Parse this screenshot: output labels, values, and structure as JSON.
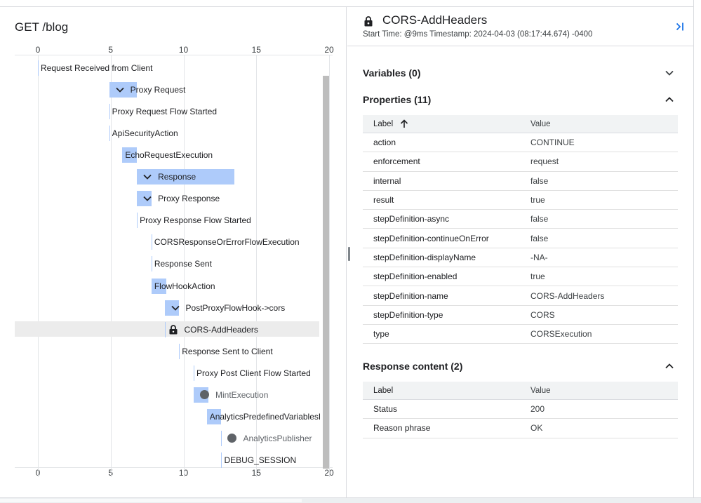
{
  "left_panel": {
    "title": "GET /blog",
    "axis_ticks": [
      "0",
      "5",
      "10",
      "15",
      "20"
    ],
    "axis_max": 20,
    "events": [
      {
        "label": "Request Received from Client",
        "start": 0,
        "end": 0,
        "expandable": false,
        "marker": "none"
      },
      {
        "label": "Proxy Request",
        "start": 4.9,
        "end": 6.8,
        "expandable": true,
        "marker": "chevron"
      },
      {
        "label": "Proxy Request Flow Started",
        "start": 4.9,
        "end": 4.9,
        "expandable": false,
        "marker": "none"
      },
      {
        "label": "ApiSecurityAction",
        "start": 4.9,
        "end": 4.9,
        "expandable": false,
        "marker": "none"
      },
      {
        "label": "EchoRequestExecution",
        "start": 5.8,
        "end": 6.8,
        "expandable": false,
        "marker": "none"
      },
      {
        "label": "Response",
        "start": 6.8,
        "end": 13.5,
        "expandable": true,
        "marker": "chevron"
      },
      {
        "label": "Proxy Response",
        "start": 6.8,
        "end": 7.8,
        "expandable": true,
        "marker": "chevron"
      },
      {
        "label": "Proxy Response Flow Started",
        "start": 6.8,
        "end": 6.8,
        "expandable": false,
        "marker": "none"
      },
      {
        "label": "CORSResponseOrErrorFlowExecution",
        "start": 7.8,
        "end": 7.8,
        "expandable": false,
        "marker": "none"
      },
      {
        "label": "Response Sent",
        "start": 7.8,
        "end": 7.8,
        "expandable": false,
        "marker": "none"
      },
      {
        "label": "FlowHookAction",
        "start": 7.8,
        "end": 8.8,
        "expandable": false,
        "marker": "none"
      },
      {
        "label": "PostProxyFlowHook->cors",
        "start": 8.7,
        "end": 9.7,
        "expandable": true,
        "marker": "chevron"
      },
      {
        "label": "CORS-AddHeaders",
        "start": 8.7,
        "end": 8.7,
        "expandable": false,
        "marker": "lock",
        "selected": true
      },
      {
        "label": "Response Sent to Client",
        "start": 9.7,
        "end": 9.7,
        "expandable": false,
        "marker": "none"
      },
      {
        "label": "Proxy Post Client Flow Started",
        "start": 10.7,
        "end": 10.7,
        "expandable": false,
        "marker": "none"
      },
      {
        "label": "MintExecution",
        "start": 10.7,
        "end": 11.7,
        "expandable": false,
        "marker": "dot",
        "muted": true
      },
      {
        "label": "AnalyticsPredefinedVariablesP",
        "start": 11.6,
        "end": 12.6,
        "expandable": false,
        "marker": "none"
      },
      {
        "label": "AnalyticsPublisher",
        "start": 12.6,
        "end": 12.6,
        "expandable": false,
        "marker": "dot",
        "muted": true
      },
      {
        "label": "DEBUG_SESSION",
        "start": 12.6,
        "end": 12.6,
        "expandable": false,
        "marker": "none"
      }
    ]
  },
  "right_panel": {
    "title": "CORS-AddHeaders",
    "subtitle": "Start Time: @9ms Timestamp: 2024-04-03 (08:17:44.674) -0400",
    "variables": {
      "title": "Variables (0)"
    },
    "properties": {
      "title": "Properties (11)",
      "col_label": "Label",
      "col_value": "Value",
      "rows": [
        {
          "label": "action",
          "value": "CONTINUE"
        },
        {
          "label": "enforcement",
          "value": "request"
        },
        {
          "label": "internal",
          "value": "false"
        },
        {
          "label": "result",
          "value": "true"
        },
        {
          "label": "stepDefinition-async",
          "value": "false"
        },
        {
          "label": "stepDefinition-continueOnError",
          "value": "false"
        },
        {
          "label": "stepDefinition-displayName",
          "value": "-NA-"
        },
        {
          "label": "stepDefinition-enabled",
          "value": "true"
        },
        {
          "label": "stepDefinition-name",
          "value": "CORS-AddHeaders"
        },
        {
          "label": "stepDefinition-type",
          "value": "CORS"
        },
        {
          "label": "type",
          "value": "CORSExecution"
        }
      ]
    },
    "response_content": {
      "title": "Response content (2)",
      "col_label": "Label",
      "col_value": "Value",
      "rows": [
        {
          "label": "Status",
          "value": "200"
        },
        {
          "label": "Reason phrase",
          "value": "OK"
        }
      ]
    }
  },
  "colors": {
    "bar": "#aecbfa",
    "accent": "#1a73e8",
    "selection": "#ececec"
  }
}
